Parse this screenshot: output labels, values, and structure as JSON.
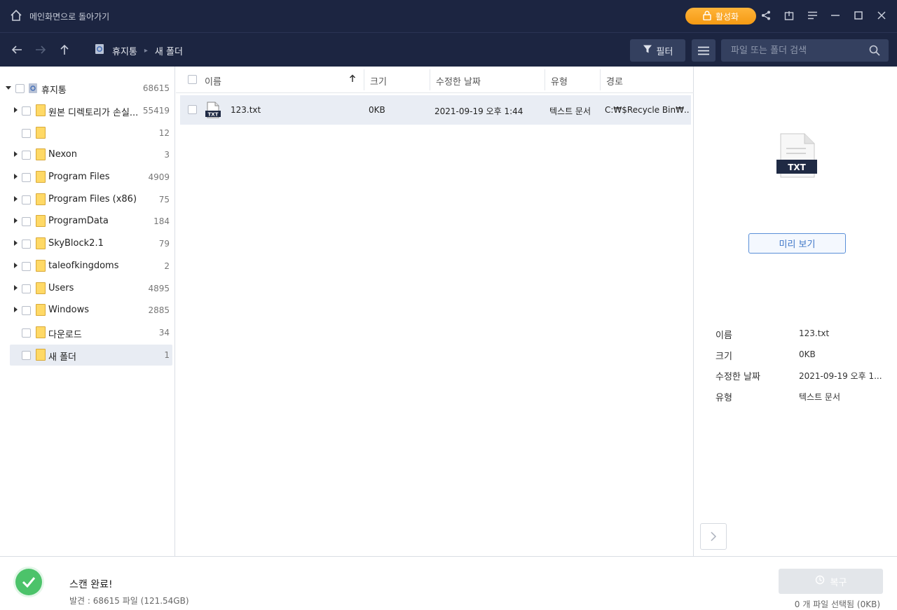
{
  "titlebar": {
    "back_label": "메인화면으로 돌아가기",
    "activate_label": "활성화"
  },
  "navbar": {
    "breadcrumb": [
      "휴지통",
      "새 폴더"
    ],
    "filter_label": "필터",
    "search_placeholder": "파일 또는 폴더 검색"
  },
  "tree": {
    "root": {
      "label": "휴지통",
      "count": "68615"
    },
    "items": [
      {
        "label": "원본 디렉토리가 손실...",
        "count": "55419",
        "expandable": true
      },
      {
        "label": "",
        "count": "12",
        "expandable": false
      },
      {
        "label": "Nexon",
        "count": "3",
        "expandable": true
      },
      {
        "label": "Program Files",
        "count": "4909",
        "expandable": true
      },
      {
        "label": "Program Files (x86)",
        "count": "75",
        "expandable": true
      },
      {
        "label": "ProgramData",
        "count": "184",
        "expandable": true
      },
      {
        "label": "SkyBlock2.1",
        "count": "79",
        "expandable": true
      },
      {
        "label": "taleofkingdoms",
        "count": "2",
        "expandable": true
      },
      {
        "label": "Users",
        "count": "4895",
        "expandable": true
      },
      {
        "label": "Windows",
        "count": "2885",
        "expandable": true
      },
      {
        "label": "다운로드",
        "count": "34",
        "expandable": false
      },
      {
        "label": "새 폴더",
        "count": "1",
        "expandable": false,
        "selected": true
      }
    ]
  },
  "table": {
    "headers": {
      "name": "이름",
      "size": "크기",
      "modified": "수정한 날짜",
      "type": "유형",
      "path": "경로"
    },
    "rows": [
      {
        "icon_label": "TXT",
        "name": "123.txt",
        "size": "0KB",
        "modified": "2021-09-19 오후 1:44",
        "type": "텍스트 문서",
        "path": "C:₩$Recycle Bin₩..."
      }
    ]
  },
  "preview": {
    "icon_label": "TXT",
    "button_label": "미리 보기",
    "info": [
      {
        "label": "이름",
        "value": "123.txt"
      },
      {
        "label": "크기",
        "value": "0KB"
      },
      {
        "label": "수정한 날짜",
        "value": "2021-09-19 오후 1..."
      },
      {
        "label": "유형",
        "value": "텍스트 문서"
      }
    ]
  },
  "footer": {
    "scan_title": "스캔 완료!",
    "scan_sub": "발견 : 68615 파일 (121.54GB)",
    "recover_label": "복구",
    "selection_info": "0 개 파일 선택됨 (0KB)"
  },
  "colors": {
    "titlebar_bg": "#1c2541",
    "accent_orange": "#f5a623",
    "success_green": "#4cc36a",
    "selected_row": "#e9edf4"
  }
}
